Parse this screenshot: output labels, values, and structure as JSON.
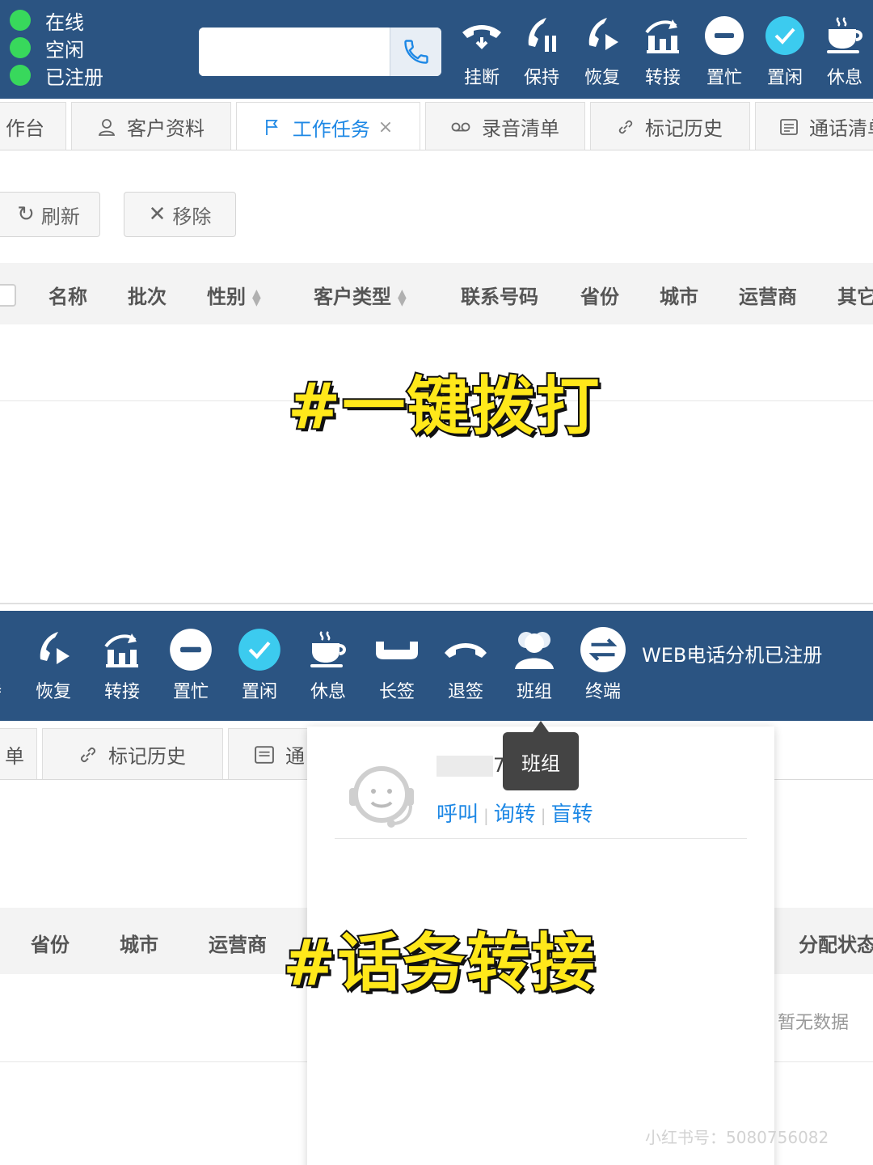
{
  "top_toolbar": {
    "status": [
      "在线",
      "空闲",
      "已注册"
    ],
    "dial_placeholder": "",
    "buttons": [
      {
        "label": "挂断",
        "icon": "hangup-icon"
      },
      {
        "label": "保持",
        "icon": "hold-icon"
      },
      {
        "label": "恢复",
        "icon": "resume-icon"
      },
      {
        "label": "转接",
        "icon": "transfer-icon"
      },
      {
        "label": "置忙",
        "icon": "busy-icon"
      },
      {
        "label": "置闲",
        "icon": "idle-check-icon"
      },
      {
        "label": "休息",
        "icon": "coffee-icon"
      }
    ]
  },
  "tabs": {
    "items": [
      {
        "label": "作台",
        "icon": ""
      },
      {
        "label": "客户资料",
        "icon": "user-icon"
      },
      {
        "label": "工作任务",
        "icon": "flag-icon",
        "active": true
      },
      {
        "label": "录音清单",
        "icon": "voicemail-icon"
      },
      {
        "label": "标记历史",
        "icon": "link-icon"
      },
      {
        "label": "通话清单",
        "icon": "list-icon"
      }
    ],
    "close": "×"
  },
  "actions": {
    "refresh": "刷新",
    "remove": "移除"
  },
  "table1": {
    "columns": [
      "名称",
      "批次",
      "性别",
      "客户类型",
      "联系号码",
      "省份",
      "城市",
      "运营商",
      "其它"
    ]
  },
  "caption1": "#一键拨打",
  "bottom_toolbar": {
    "buttons": [
      {
        "label": "保持",
        "icon": "hold-icon"
      },
      {
        "label": "恢复",
        "icon": "resume-icon"
      },
      {
        "label": "转接",
        "icon": "transfer-icon"
      },
      {
        "label": "置忙",
        "icon": "busy-icon"
      },
      {
        "label": "置闲",
        "icon": "idle-check-icon"
      },
      {
        "label": "休息",
        "icon": "coffee-icon"
      },
      {
        "label": "长签",
        "icon": "long-sign-icon"
      },
      {
        "label": "退签",
        "icon": "sign-out-icon"
      },
      {
        "label": "班组",
        "icon": "team-icon"
      },
      {
        "label": "终端",
        "icon": "terminal-switch-icon"
      }
    ],
    "registered_text": "WEB电话分机已注册"
  },
  "tabs2": {
    "items": [
      {
        "label": "单"
      },
      {
        "label": "标记历史"
      },
      {
        "label": "通"
      }
    ]
  },
  "popup": {
    "agent_suffix": "7",
    "agent_ext": "(…)",
    "actions": [
      "呼叫",
      "询转",
      "盲转"
    ]
  },
  "tooltip": "班组",
  "table2": {
    "columns": [
      "省份",
      "城市",
      "运营商",
      "分配状态"
    ],
    "empty": "暂无数据"
  },
  "caption2": "#话务转接",
  "watermark": "小红书号：5080756082",
  "colors": {
    "toolbar": "#2b5482",
    "online": "#38d85c",
    "accent": "#1e88e5",
    "caption": "#ffe81a"
  }
}
